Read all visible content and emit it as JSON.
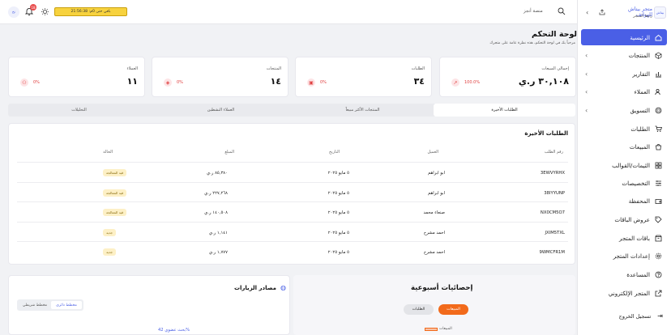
{
  "header": {
    "store_name": "متجر بيتاش للهواتف",
    "store_sub": "رابط المتجر",
    "store_link": "منصة أنجز",
    "trial_label": "باقي حتى 0م: 21:56:38",
    "notif_count": "18",
    "user_initials": "نخ"
  },
  "sidebar": {
    "items": [
      {
        "label": "الرئيسية",
        "active": true,
        "chevron": false,
        "icon": "home-icon"
      },
      {
        "label": "المنتجات",
        "chevron": true,
        "icon": "cube-icon"
      },
      {
        "label": "التقارير",
        "chevron": true,
        "icon": "chart-icon"
      },
      {
        "label": "العملاء",
        "chevron": true,
        "icon": "users-icon"
      },
      {
        "label": "التسويق",
        "chevron": true,
        "icon": "megaphone-icon"
      },
      {
        "label": "الطلبات",
        "chevron": false,
        "icon": "cart-icon"
      },
      {
        "label": "المبيعات",
        "chevron": false,
        "icon": "bag-icon"
      },
      {
        "label": "الثيمات/القوالب",
        "chevron": false,
        "icon": "grid-icon"
      },
      {
        "label": "التخصيصات",
        "chevron": false,
        "icon": "sliders-icon"
      },
      {
        "label": "المحفظة",
        "chevron": false,
        "icon": "wallet-icon"
      },
      {
        "label": "عروض الباقات",
        "chevron": false,
        "icon": "tag-icon"
      },
      {
        "label": "باقات المتجر",
        "chevron": false,
        "icon": "box-icon"
      },
      {
        "label": "إعدادات المتجر",
        "chevron": false,
        "icon": "gear-icon"
      },
      {
        "label": "المساعدة",
        "chevron": false,
        "icon": "help-icon"
      },
      {
        "label": "المتجر الإلكتروني",
        "chevron": false,
        "icon": "external-link-icon"
      }
    ],
    "logout": "تسجيل الخروج"
  },
  "page": {
    "title": "لوحة التحكم",
    "subtitle": "مرحباً بك في لوحة التحكم، هذه نظرة عامة على متجرك"
  },
  "cards": [
    {
      "label": "إجمالي المبيعات",
      "value": "٣٠,١٠٨ ر.ي",
      "badge": "100.0%",
      "color": "#e84a4a"
    },
    {
      "label": "الطلبات",
      "value": "٣٤",
      "badge": "0%",
      "color": "#e84a4a"
    },
    {
      "label": "المنتجات",
      "value": "١٤",
      "badge": "0%",
      "color": "#e84a4a"
    },
    {
      "label": "العملاء",
      "value": "١١",
      "badge": "0%",
      "color": "#e84a4a"
    }
  ],
  "tabs": [
    "الطلبات الأخيرة",
    "المنتجات الأكثر مبيعاً",
    "العملاء النشطين",
    "التحليلات"
  ],
  "orders": {
    "title": "الطلبات الأخيرة",
    "columns": [
      "رقم الطلب",
      "العميل",
      "التاريخ",
      "المبلغ",
      "الحالة"
    ],
    "rows": [
      {
        "id": "3EWVYRHX",
        "customer": "ابو ابراهم",
        "date": "٥ مايو ٢٠٢٥",
        "amount": "٨٥,٣٨٠ ر.ي",
        "status": "قيد المعالجة"
      },
      {
        "id": "38IYYUNP",
        "customer": "ابو ابراهم",
        "date": "٥ مايو ٢٠٢٥",
        "amount": "٢٢٧,٢٦٨ ر.ي",
        "status": "قيد المعالجة"
      },
      {
        "id": "NX0CM5O7",
        "customer": "صنعاء محمد",
        "date": "٥ مايو ٢٠٢٥",
        "amount": "١٤٠,٥٠٨ ر.ي",
        "status": "قيد المعالجة"
      },
      {
        "id": "JXIM5TXL",
        "customer": "احمد مشرح",
        "date": "٥ مايو ٢٠٢٥",
        "amount": "١,١٤١ ر.ي",
        "status": "جديد"
      },
      {
        "id": "9WMCFR1M",
        "customer": "احمد مشرح",
        "date": "٥ مايو ٢٠٢٥",
        "amount": "١,٧٧٧ ر.ي",
        "status": "جديد"
      }
    ]
  },
  "weekly": {
    "title": "إحصائيات أسبوعية",
    "btn_sales": "المبيعات",
    "btn_orders": "الطلبات",
    "legend": "المبيعات"
  },
  "traffic": {
    "title": "مصادر الزيارات",
    "btn_bar": "مخطط شريطي",
    "btn_donut": "مخطط دائري",
    "search_rate": "بحث عضوي 42%"
  },
  "colors": {
    "accent": "#4a5fe6",
    "orange": "#f26a1b",
    "trial_bg": "#f7d23e"
  }
}
